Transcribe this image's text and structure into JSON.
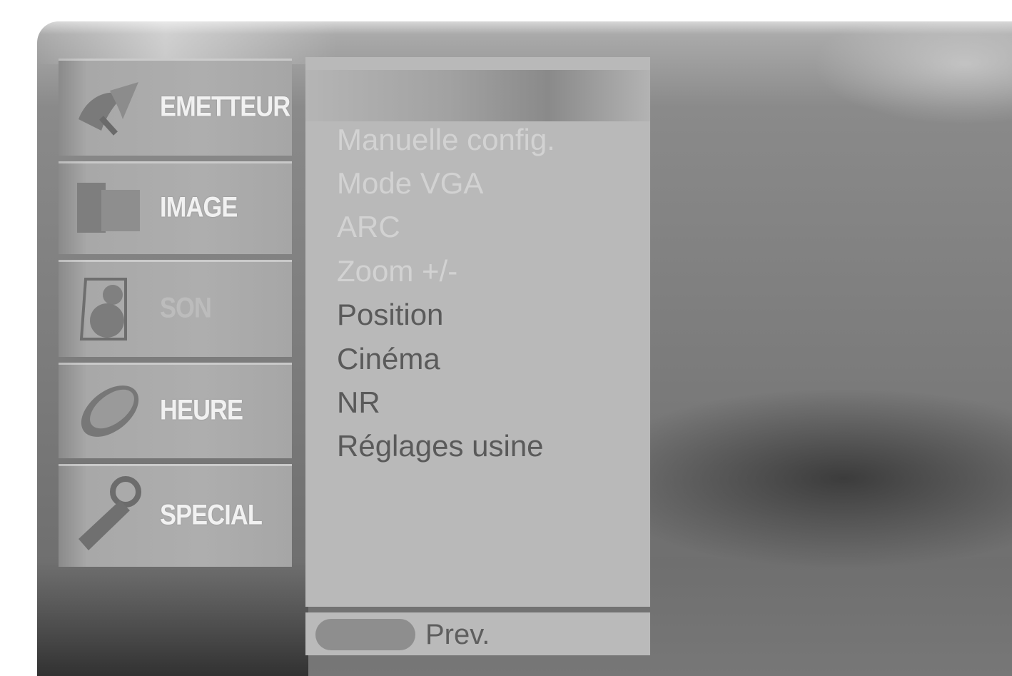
{
  "categories": [
    {
      "label": "EMETTEUR",
      "icon": "satellite-dish-icon"
    },
    {
      "label": "IMAGE",
      "icon": "monitor-icon"
    },
    {
      "label": "SON",
      "icon": "speaker-icon"
    },
    {
      "label": "HEURE",
      "icon": "clock-icon"
    },
    {
      "label": "SPECIAL",
      "icon": "wrench-icon"
    }
  ],
  "menu": {
    "items": [
      "Manuelle config.",
      "Mode VGA",
      "ARC",
      "Zoom +/-",
      "Position",
      "Cinéma",
      "NR",
      "Réglages usine"
    ]
  },
  "footer": {
    "key_label": "Prev."
  }
}
